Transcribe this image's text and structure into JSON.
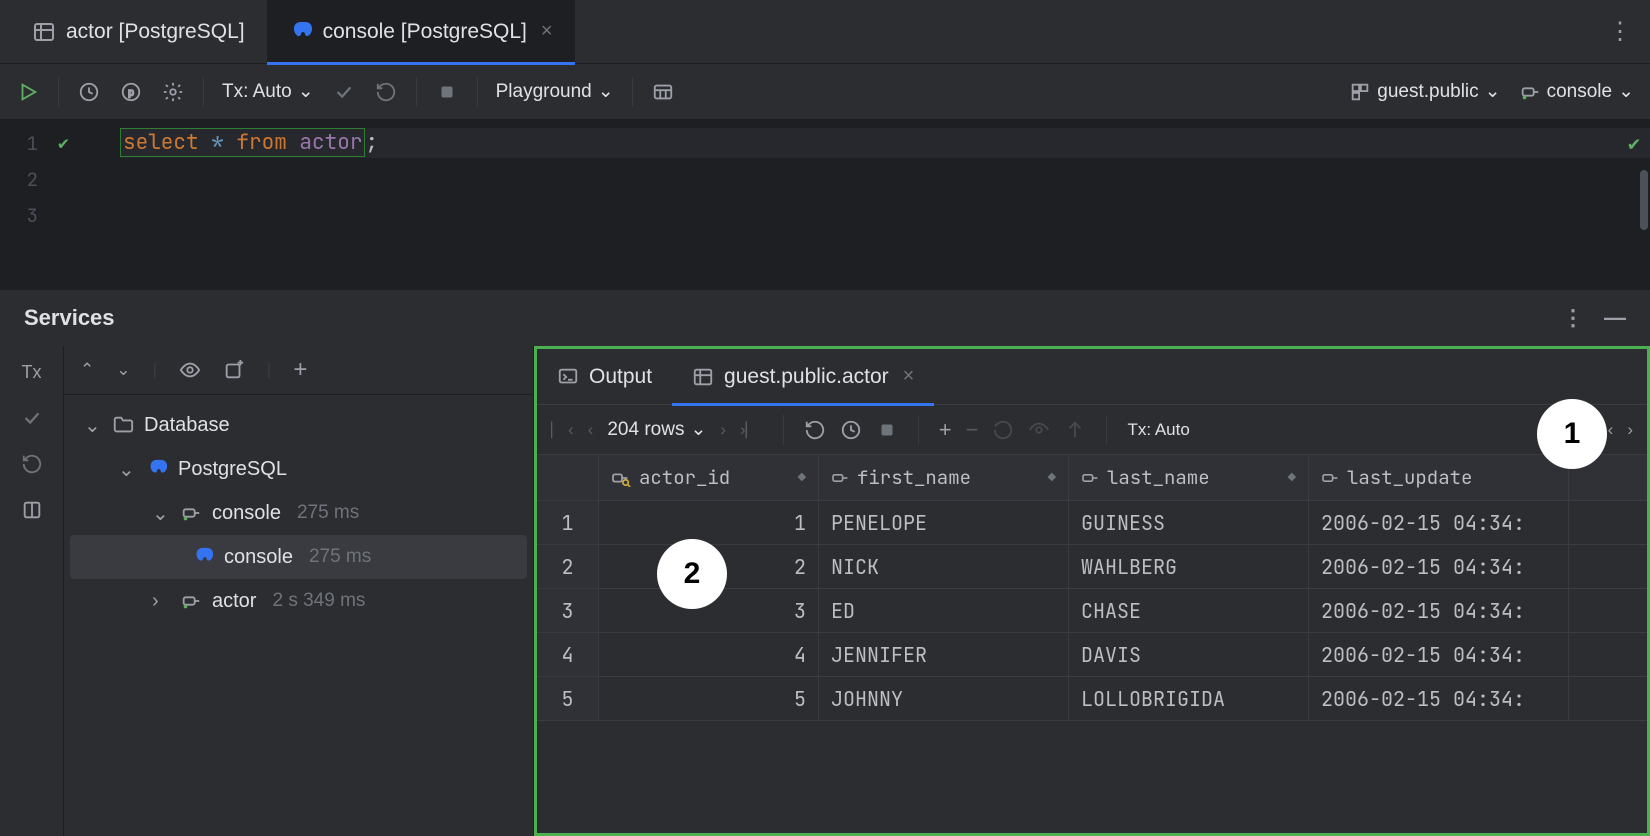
{
  "tabs": {
    "first": {
      "label": "actor [PostgreSQL]"
    },
    "second": {
      "label": "console [PostgreSQL]"
    }
  },
  "toolbar": {
    "tx_label": "Tx: Auto",
    "playground_label": "Playground",
    "schema_label": "guest.public",
    "connection_label": "console"
  },
  "editor": {
    "sql_keyword1": "select",
    "sql_star": " * ",
    "sql_keyword2": "from",
    "sql_table": " actor",
    "sql_semi": ";",
    "line1": "1",
    "line2": "2",
    "line3": "3"
  },
  "services": {
    "title": "Services"
  },
  "tree": {
    "root": "Database",
    "pg": "PostgreSQL",
    "console": "console",
    "console_time": "275 ms",
    "console2": "console",
    "console2_time": "275 ms",
    "actor": "actor",
    "actor_time": "2 s 349 ms"
  },
  "results": {
    "output_tab": "Output",
    "active_tab": "guest.public.actor",
    "rowcount": "204 rows",
    "tx_label": "Tx: Auto",
    "columns": {
      "c1": "actor_id",
      "c2": "first_name",
      "c3": "last_name",
      "c4": "last_update"
    },
    "rows": [
      {
        "n": "1",
        "id": "1",
        "fn": "PENELOPE",
        "ln": "GUINESS",
        "lu": "2006-02-15 04:34:"
      },
      {
        "n": "2",
        "id": "2",
        "fn": "NICK",
        "ln": "WAHLBERG",
        "lu": "2006-02-15 04:34:"
      },
      {
        "n": "3",
        "id": "3",
        "fn": "ED",
        "ln": "CHASE",
        "lu": "2006-02-15 04:34:"
      },
      {
        "n": "4",
        "id": "4",
        "fn": "JENNIFER",
        "ln": "DAVIS",
        "lu": "2006-02-15 04:34:"
      },
      {
        "n": "5",
        "id": "5",
        "fn": "JOHNNY",
        "ln": "LOLLOBRIGIDA",
        "lu": "2006-02-15 04:34:"
      }
    ]
  },
  "callouts": {
    "one": "1",
    "two": "2"
  }
}
